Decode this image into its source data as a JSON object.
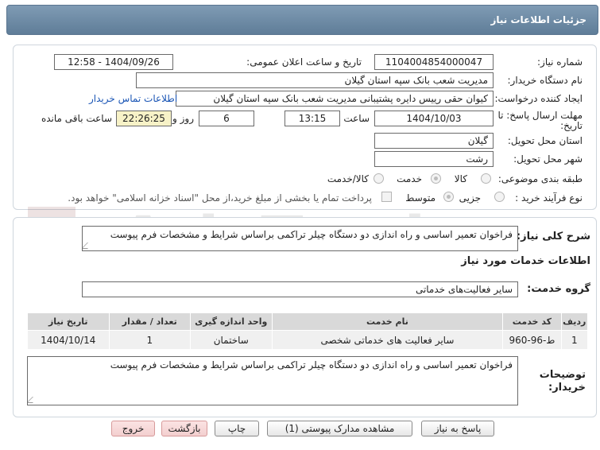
{
  "header": {
    "title": "جزئیات اطلاعات نیاز"
  },
  "form": {
    "need_number_label": "شماره نیاز:",
    "need_number": "1104004854000047",
    "announce_label": "تاریخ و ساعت اعلان عمومی:",
    "announce_value": "1404/09/26 - 12:58",
    "buyer_org_label": "نام دستگاه خریدار:",
    "buyer_org": "مدیریت شعب بانک سپه استان گیلان",
    "requester_label": "ایجاد کننده درخواست:",
    "requester": "کیوان حقی رییس دایره پشتیبانی  مدیریت شعب بانک سپه استان گیلان",
    "contact_link": "اطلاعات تماس خریدار",
    "deadline_label_1": "مهلت ارسال پاسخ: تا",
    "deadline_label_2": "تاریخ:",
    "deadline_date": "1404/10/03",
    "time_label": "ساعت",
    "deadline_time": "13:15",
    "days_value": "6",
    "days_label": "روز و",
    "remaining_time": "22:26:25",
    "remaining_label": "ساعت باقی مانده",
    "province_label": "استان محل تحویل:",
    "province": "گیلان",
    "city_label": "شهر محل تحویل:",
    "city": "رشت",
    "category_label": "طبقه بندی موضوعی:",
    "category_options": [
      "کالا",
      "خدمت",
      "کالا/خدمت"
    ],
    "process_label": "نوع فرآیند خرید :",
    "process_options": [
      "جزیی",
      "متوسط"
    ],
    "payment_note": "پرداخت تمام یا بخشی از مبلغ خرید،از محل \"اسناد خزانه اسلامی\" خواهد بود."
  },
  "description": {
    "label": "شرح کلی نیاز:",
    "text": "فراخوان تعمیر اساسی و راه اندازی دو دستگاه چیلر تراکمی براساس شرایط و مشخصات فرم پیوست"
  },
  "services": {
    "section_title": "اطلاعات خدمات مورد نیاز",
    "group_label": "گروه خدمت:",
    "group_value": "سایر فعالیت‌های خدماتی",
    "table": {
      "headers": [
        "ردیف",
        "کد خدمت",
        "نام خدمت",
        "واحد اندازه گیری",
        "تعداد / مقدار",
        "تاریخ نیاز"
      ],
      "rows": [
        [
          "1",
          "ط-96-960",
          "سایر فعالیت های خدماتی شخصی",
          "ساختمان",
          "1",
          "1404/10/14"
        ]
      ]
    }
  },
  "buyer_notes": {
    "label_1": "توضیحات",
    "label_2": "خریدار:",
    "text": "فراخوان تعمیر اساسی و راه اندازی دو دستگاه چیلر تراکمی براساس شرایط و مشخصات فرم پیوست"
  },
  "buttons": {
    "reply": "پاسخ به نیاز",
    "attachments": "مشاهده مدارک پیوستی (1)",
    "print": "چاپ",
    "back": "بازگشت",
    "exit": "خروج"
  },
  "watermark": {
    "text": "AriaTender.net"
  },
  "colors": {
    "header_bg": "#6f8ca6",
    "link": "#1a55b5",
    "remaining_bg": "#f7f2c7",
    "button_pink": "#f3cfcf"
  }
}
